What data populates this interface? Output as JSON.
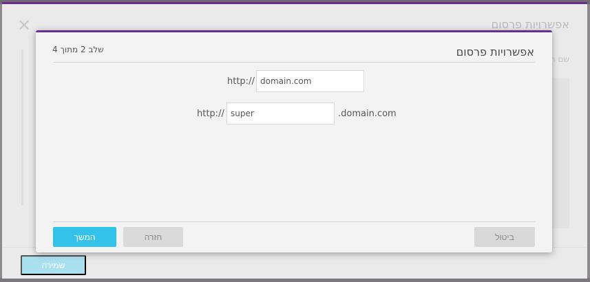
{
  "outer": {
    "title": "אפשרויות פרסום",
    "field_label": "שם ה",
    "save_label": "שמירה"
  },
  "dialog": {
    "title": "אפשרויות פרסום",
    "step": "שלב 2 מתוך 4",
    "row1": {
      "prefix": "http://",
      "value": "domain.com"
    },
    "row2": {
      "prefix": "http://",
      "value": "super",
      "suffix": ".domain.com"
    },
    "buttons": {
      "continue": "המשך",
      "back": "חזרה",
      "cancel": "ביטול"
    }
  },
  "colors": {
    "accent": "#6a2c91",
    "primary_button": "#33c3ea"
  },
  "icons": {
    "close": "close-icon"
  }
}
